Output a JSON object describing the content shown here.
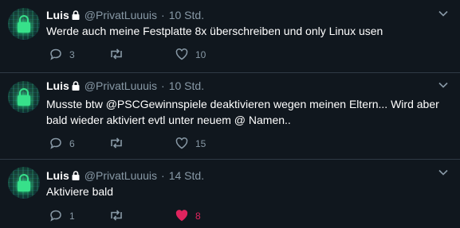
{
  "colors": {
    "background": "#10171e",
    "secondary_text": "#8899a6",
    "like_active": "#e0245e"
  },
  "tweets": [
    {
      "name": "Luis",
      "handle": "@PrivatLuuuis",
      "separator": "·",
      "time": "10 Std.",
      "text": "Werde auch meine Festplatte 8x überschreiben und only Linux usen",
      "replies": "3",
      "retweets": "",
      "likes": "10",
      "liked": false
    },
    {
      "name": "Luis",
      "handle": "@PrivatLuuuis",
      "separator": "·",
      "time": "10 Std.",
      "text": "Musste btw @PSCGewinnspiele deaktivieren wegen meinen Eltern... Wird aber bald wieder aktiviert evtl unter neuem @ Namen..",
      "replies": "6",
      "retweets": "",
      "likes": "15",
      "liked": false
    },
    {
      "name": "Luis",
      "handle": "@PrivatLuuuis",
      "separator": "·",
      "time": "14 Std.",
      "text": "Aktiviere bald",
      "replies": "1",
      "retweets": "",
      "likes": "8",
      "liked": true
    }
  ]
}
